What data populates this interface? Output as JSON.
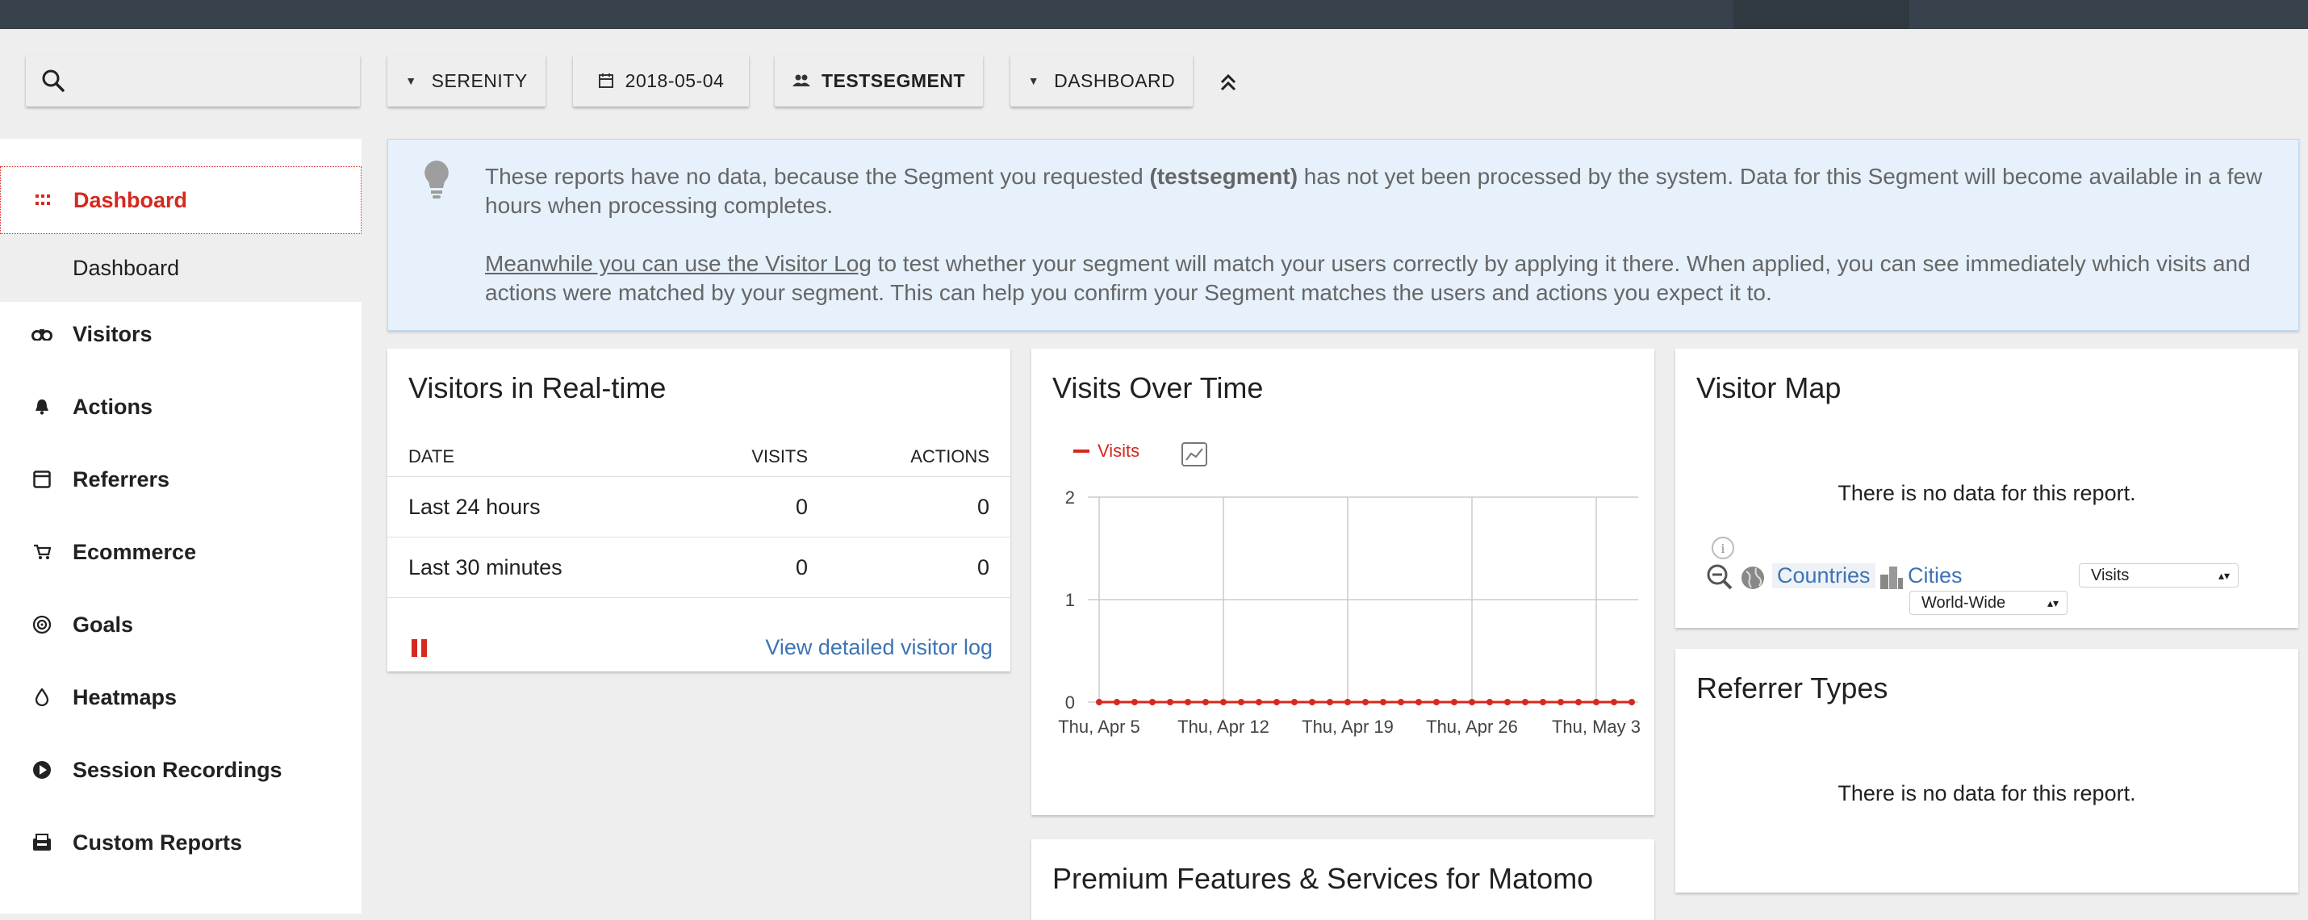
{
  "toolbar": {
    "site": "SERENITY",
    "date": "2018-05-04",
    "segment": "TESTSEGMENT",
    "dashboard": "DASHBOARD"
  },
  "sidebar": {
    "items": [
      {
        "label": "Dashboard",
        "icon": "grid-icon"
      },
      {
        "label": "Dashboard",
        "icon": ""
      },
      {
        "label": "Visitors",
        "icon": "binoculars-icon"
      },
      {
        "label": "Actions",
        "icon": "bell-icon"
      },
      {
        "label": "Referrers",
        "icon": "window-icon"
      },
      {
        "label": "Ecommerce",
        "icon": "cart-icon"
      },
      {
        "label": "Goals",
        "icon": "target-icon"
      },
      {
        "label": "Heatmaps",
        "icon": "drop-icon"
      },
      {
        "label": "Session Recordings",
        "icon": "play-icon"
      },
      {
        "label": "Custom Reports",
        "icon": "report-icon"
      }
    ]
  },
  "notice": {
    "line1_pre": "These reports have no data, because the Segment you requested ",
    "line1_bold": "(testsegment)",
    "line1_post": " has not yet been processed by the system. Data for this Segment will become available in a few hours when processing completes.",
    "link": "Meanwhile you can use the Visitor Log",
    "line2_post": " to test whether your segment will match your users correctly by applying it there. When applied, you can see immediately which visits and actions were matched by your segment. This can help you confirm your Segment matches the users and actions you expect it to."
  },
  "realtime": {
    "title": "Visitors in Real-time",
    "columns": [
      "DATE",
      "VISITS",
      "ACTIONS"
    ],
    "rows": [
      [
        "Last 24 hours",
        "0",
        "0"
      ],
      [
        "Last 30 minutes",
        "0",
        "0"
      ]
    ],
    "link": "View detailed visitor log"
  },
  "visits_chart": {
    "title": "Visits Over Time",
    "legend": "Visits"
  },
  "chart_data": {
    "type": "line",
    "title": "Visits Over Time",
    "series": [
      {
        "name": "Visits",
        "values": [
          0,
          0,
          0,
          0,
          0,
          0,
          0,
          0,
          0,
          0,
          0,
          0,
          0,
          0,
          0,
          0,
          0,
          0,
          0,
          0,
          0,
          0,
          0,
          0,
          0,
          0,
          0,
          0,
          0,
          0,
          0
        ]
      }
    ],
    "y_ticks": [
      "0",
      "1",
      "2"
    ],
    "ylim": [
      0,
      2
    ],
    "x_tick_labels": [
      "Thu, Apr 5",
      "Thu, Apr 12",
      "Thu, Apr 19",
      "Thu, Apr 26",
      "Thu, May 3"
    ],
    "color": "#d4291f"
  },
  "map": {
    "title": "Visitor Map",
    "nodata": "There is no data for this report.",
    "countries": "Countries",
    "cities": "Cities",
    "metric": "Visits",
    "region": "World-Wide"
  },
  "referrers": {
    "title": "Referrer Types",
    "nodata": "There is no data for this report."
  },
  "premium": {
    "title": "Premium Features & Services for Matomo"
  }
}
